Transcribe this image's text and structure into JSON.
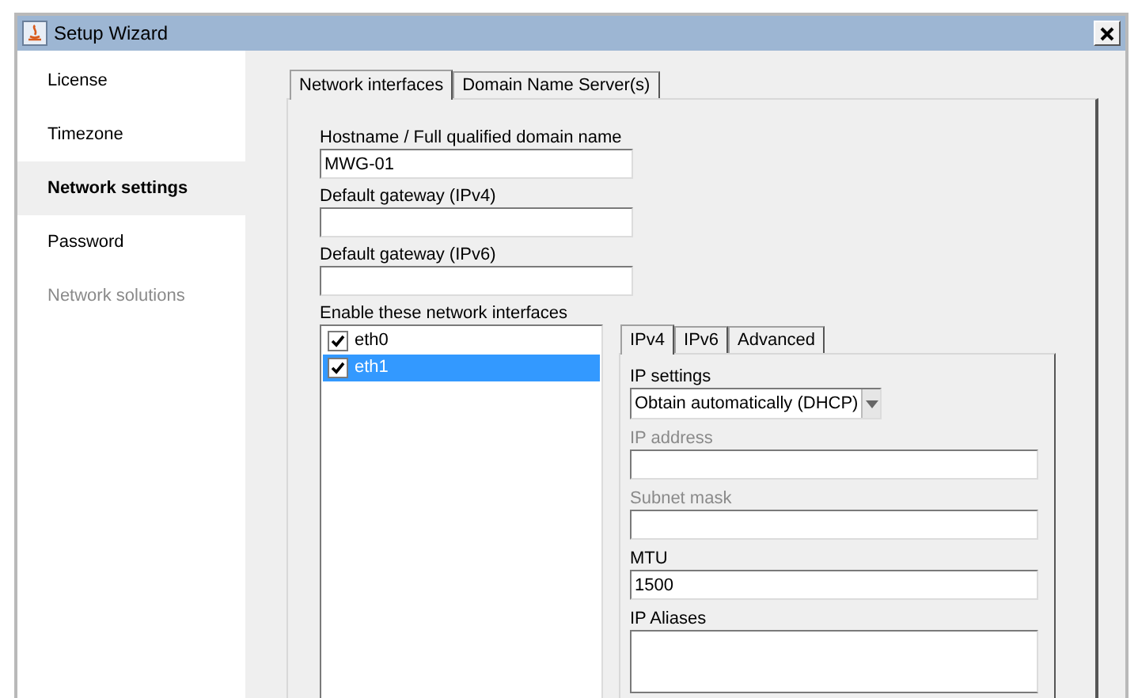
{
  "window": {
    "title": "Setup Wizard"
  },
  "sidebar": {
    "items": [
      {
        "label": "License",
        "selected": false,
        "disabled": false
      },
      {
        "label": "Timezone",
        "selected": false,
        "disabled": false
      },
      {
        "label": "Network settings",
        "selected": true,
        "disabled": false
      },
      {
        "label": "Password",
        "selected": false,
        "disabled": false
      },
      {
        "label": "Network solutions",
        "selected": false,
        "disabled": true
      }
    ]
  },
  "tabs": [
    {
      "label": "Network interfaces",
      "selected": true
    },
    {
      "label": "Domain Name Server(s)",
      "selected": false
    }
  ],
  "fields": [
    {
      "label": "Hostname / Full qualified domain name",
      "value": "MWG-01"
    },
    {
      "label": "Default gateway (IPv4)"
    },
    {
      "label": "Default gateway (IPv6)"
    }
  ],
  "interfaces": {
    "label": "Enable these network interfaces",
    "items": [
      {
        "name": "eth0",
        "checked": true,
        "selected": false
      },
      {
        "name": "eth1",
        "checked": true,
        "selected": true
      }
    ]
  },
  "ip_tabs": [
    {
      "label": "IPv4",
      "selected": true
    },
    {
      "label": "IPv6",
      "selected": false
    },
    {
      "label": "Advanced",
      "selected": false
    }
  ],
  "ip_fields": [
    {
      "kind": "select",
      "label": "IP settings",
      "value": "Obtain automatically (DHCP)",
      "disabled": false
    },
    {
      "kind": "text",
      "label": "IP address",
      "disabled": true
    },
    {
      "kind": "text",
      "label": "Subnet mask",
      "disabled": true
    },
    {
      "kind": "text",
      "label": "MTU",
      "value": "1500",
      "disabled": false
    },
    {
      "kind": "area",
      "label": "IP Aliases",
      "disabled": false
    }
  ]
}
